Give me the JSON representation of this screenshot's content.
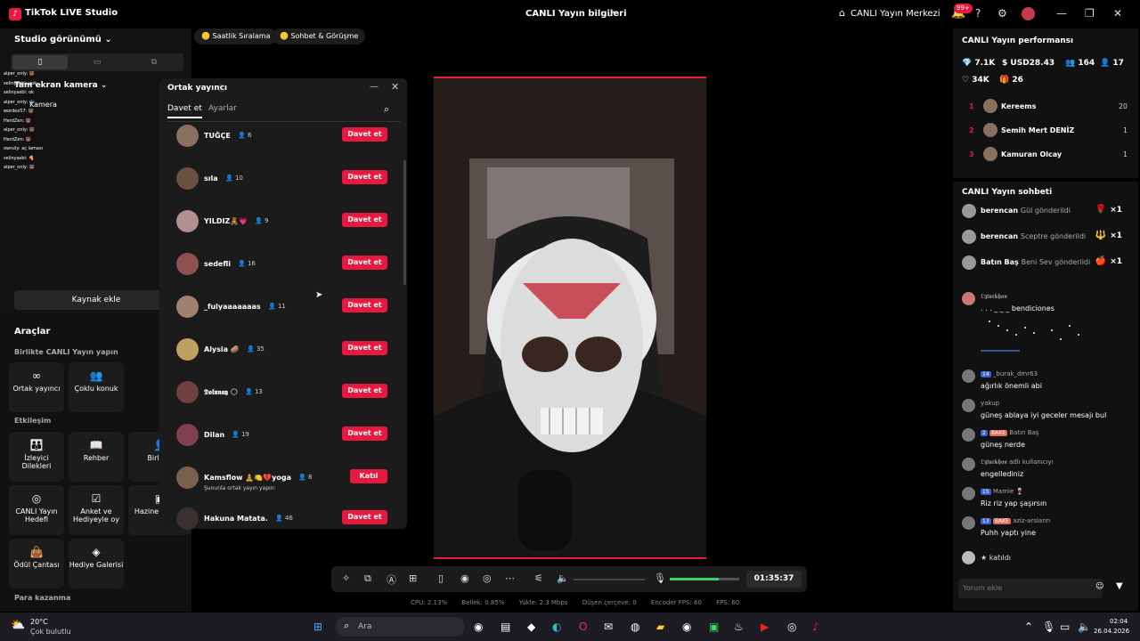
{
  "titlebar": {
    "app": "TikTok LIVE Studio",
    "center": "CANLI Yayın bilgileri",
    "live_center": "CANLI Yayın Merkezi",
    "badge": "99+"
  },
  "left": {
    "studio_view": "Studio görünümü",
    "camera": "Tam ekran kamera",
    "camera_sub": "Kamera",
    "add_source": "Kaynak ekle",
    "tools": "Araçlar",
    "sec_collab": "Birlikte CANLI Yayın yapın",
    "sec_interaction": "Etkileşim",
    "sec_earn": "Para kazanma",
    "tool_cohost": "Ortak yayıncı",
    "tool_multi": "Çoklu konuk",
    "tool_wishes": "İzleyici Dilekleri",
    "tool_guide": "Rehber",
    "tool_together": "Birlikte",
    "tool_goal": "CANLI Yayın Hedefi",
    "tool_poll": "Anket ve Hediyeyle oy",
    "tool_box": "Hazine Kutusu",
    "tool_prizebag": "Ödül Çantası",
    "tool_gallery": "Hediye Galerisi",
    "mini_chat": [
      "alper_only: 🐻",
      "selinyasbi: yok",
      "selinyasbi: ok",
      "alper_only: 🐳",
      "wordex57: 🐻",
      "HerdZen: 🐻",
      "alper_only: 🐻",
      "HerdZen: 🐻",
      "ownzly: aç laması",
      "selinyasbi: 🍕",
      "alper_only: 🐻"
    ]
  },
  "chips": {
    "hourly": "Saatlik Sıralama",
    "chat": "Sohbet & Görüşme"
  },
  "panel": {
    "title": "Ortak yayıncı",
    "tab_invite": "Davet et",
    "tab_settings": "Ayarlar",
    "invite_label": "Davet et",
    "join_label": "Katıl",
    "rows": [
      {
        "name": "TUĞÇE",
        "count": "6"
      },
      {
        "name": "sıla",
        "count": "10"
      },
      {
        "name": "YILDIZ🧸💗",
        "count": "9"
      },
      {
        "name": "sedefli",
        "count": "16"
      },
      {
        "name": "_fulyaaaaaaas",
        "count": "11"
      },
      {
        "name": "Alysia 🥔",
        "count": "35"
      },
      {
        "name": "𝕯𝖔𝖑𝖚𝖓𝖆𝖞 🌕",
        "count": "13"
      },
      {
        "name": "Dilan",
        "count": "19"
      },
      {
        "name": "Kamsflow 🧘🍋💔yoga",
        "count": "8",
        "sub": "Şununla ortak yayın yapın:"
      },
      {
        "name": "Hakuna Matata.",
        "count": "46"
      }
    ]
  },
  "controls": {
    "timer": "01:35:37"
  },
  "stats": {
    "cpu": "CPU: 2.13%",
    "mem": "Bellek: 0.85%",
    "upload": "Yükle: 2.3 Mbps",
    "dropped": "Düşen çerçeve: 0",
    "encoder": "Encoder FPS: 60",
    "fps": "FPS: 60"
  },
  "perf": {
    "title": "CANLI Yayın performansı",
    "diamonds": "7.1K",
    "usd": "USD28.43",
    "viewers": "164",
    "new_followers": "17",
    "likes": "34K",
    "gifts": "26",
    "ranks": [
      {
        "n": "1",
        "name": "Kereems",
        "v": "20"
      },
      {
        "n": "2",
        "name": "Semih Mert DENİZ",
        "v": "1"
      },
      {
        "n": "3",
        "name": "Kamuran Olcay",
        "v": "1"
      }
    ]
  },
  "chat": {
    "title": "CANLI Yayın sohbeti",
    "gifts": [
      {
        "name": "berencan",
        "text": "Gül gönderildi",
        "count": "×1",
        "icon": "🌹"
      },
      {
        "name": "berencan",
        "text": "Sceptre gönderildi",
        "count": "×1",
        "icon": "🔱"
      },
      {
        "name": "Batın Baş",
        "text": "Beni Sev gönderildi",
        "count": "×1",
        "icon": "🍎"
      }
    ],
    "art_user": "𝕺𝖟𝖙𝖚𝖗𝖐𝖍𝖆𝖓",
    "art_text": ". . . _ _ _ bendiciones",
    "messages": [
      {
        "lvl": "14",
        "user": "_burak_dmr63",
        "text": "ağırlık önemli abi"
      },
      {
        "user": "yakup",
        "text": "güneş ablaya iyi geceler mesajı bul"
      },
      {
        "lvl": "2",
        "fan": "BAKE",
        "user": "Batın Baş",
        "text": "güneş nerde"
      },
      {
        "user": "𝕺𝖟𝖙𝖚𝖗𝖐𝖍𝖆𝖓 adlı kullanıcıyı",
        "text": "engellediniz"
      },
      {
        "lvl": "15",
        "user": "Mamie 🍷",
        "text": "Riz riz yap şaşırsın"
      },
      {
        "lvl": "13",
        "fan": "BAKE",
        "user": "aziz-arslann",
        "text": "Puhh yaptı yine"
      }
    ],
    "joined": "katıldı",
    "comment_placeholder": "Yorum ekle"
  },
  "taskbar": {
    "temp": "20°C",
    "weather": "Çok bulutlu",
    "search": "Ara",
    "time": "02:04",
    "date": "26.04.2026"
  }
}
